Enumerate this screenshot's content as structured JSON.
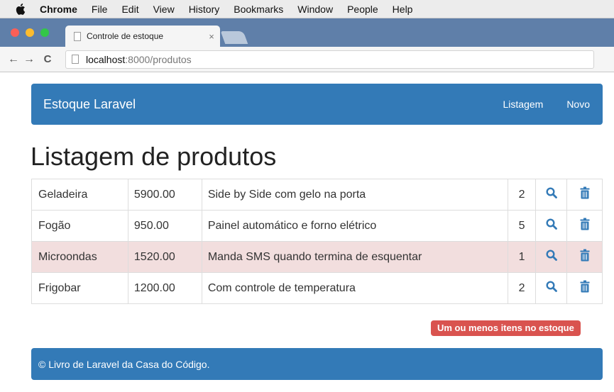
{
  "menubar": {
    "app": "Chrome",
    "items": [
      "File",
      "Edit",
      "View",
      "History",
      "Bookmarks",
      "Window",
      "People",
      "Help"
    ]
  },
  "browser": {
    "tab_title": "Controle de estoque",
    "tab_close": "×",
    "url_host": "localhost",
    "url_path": ":8000/produtos"
  },
  "navbar": {
    "brand": "Estoque Laravel",
    "links": [
      "Listagem",
      "Novo"
    ]
  },
  "page_title": "Listagem de produtos",
  "products": [
    {
      "name": "Geladeira",
      "price": "5900.00",
      "description": "Side by Side com gelo na porta",
      "quantity": "2",
      "low_stock": false
    },
    {
      "name": "Fogão",
      "price": "950.00",
      "description": "Painel automático e forno elétrico",
      "quantity": "5",
      "low_stock": false
    },
    {
      "name": "Microondas",
      "price": "1520.00",
      "description": "Manda SMS quando termina de esquentar",
      "quantity": "1",
      "low_stock": true
    },
    {
      "name": "Frigobar",
      "price": "1200.00",
      "description": "Com controle de temperatura",
      "quantity": "2",
      "low_stock": false
    }
  ],
  "row_icons": {
    "view": "search-icon",
    "delete": "trash-icon"
  },
  "low_stock_badge": "Um ou menos itens no estoque",
  "footer": "© Livro de Laravel da Casa do Código.",
  "colors": {
    "primary": "#337ab7",
    "danger": "#d9534f",
    "danger_row": "#f2dede",
    "tab_strip": "#5f7fa9"
  }
}
